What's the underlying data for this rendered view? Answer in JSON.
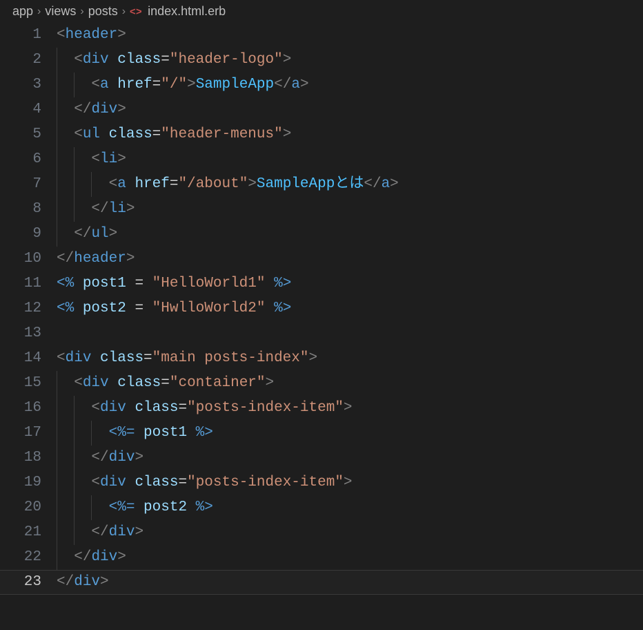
{
  "breadcrumb": {
    "segments": [
      "app",
      "views",
      "posts",
      "index.html.erb"
    ]
  },
  "editor": {
    "activeLine": 23,
    "lineNumbers": [
      "1",
      "2",
      "3",
      "4",
      "5",
      "6",
      "7",
      "8",
      "9",
      "10",
      "11",
      "12",
      "13",
      "14",
      "15",
      "16",
      "17",
      "18",
      "19",
      "20",
      "21",
      "22",
      "23"
    ]
  },
  "code": {
    "l1": {
      "open": "<",
      "tag": "header",
      "close": ">"
    },
    "l2": {
      "indent": 1,
      "open": "<",
      "tag": "div",
      "attr": "class",
      "eq": "=",
      "val": "\"header-logo\"",
      "close": ">"
    },
    "l3": {
      "indent": 2,
      "open": "<",
      "tag": "a",
      "attr": "href",
      "eq": "=",
      "val": "\"/\"",
      "mid": ">",
      "text": "SampleApp",
      "endopen": "</",
      "endtag": "a",
      "endclose": ">"
    },
    "l4": {
      "indent": 1,
      "open": "</",
      "tag": "div",
      "close": ">"
    },
    "l5": {
      "indent": 1,
      "open": "<",
      "tag": "ul",
      "attr": "class",
      "eq": "=",
      "val": "\"header-menus\"",
      "close": ">"
    },
    "l6": {
      "indent": 2,
      "open": "<",
      "tag": "li",
      "close": ">"
    },
    "l7": {
      "indent": 3,
      "open": "<",
      "tag": "a",
      "attr": "href",
      "eq": "=",
      "val": "\"/about\"",
      "mid": ">",
      "text": "SampleAppとは",
      "endopen": "</",
      "endtag": "a",
      "endclose": ">"
    },
    "l8": {
      "indent": 2,
      "open": "</",
      "tag": "li",
      "close": ">"
    },
    "l9": {
      "indent": 1,
      "open": "</",
      "tag": "ul",
      "close": ">"
    },
    "l10": {
      "open": "</",
      "tag": "header",
      "close": ">"
    },
    "l11": {
      "erbopen": "<%",
      "sp": " ",
      "var": "post1",
      "op": " = ",
      "val": "\"HelloWorld1\"",
      "sp2": " ",
      "erbclose": "%>"
    },
    "l12": {
      "erbopen": "<%",
      "sp": " ",
      "var": "post2",
      "op": " = ",
      "val": "\"HwlloWorld2\"",
      "sp2": " ",
      "erbclose": "%>"
    },
    "l13": {
      "blank": ""
    },
    "l14": {
      "open": "<",
      "tag": "div",
      "attr": "class",
      "eq": "=",
      "val": "\"main posts-index\"",
      "close": ">"
    },
    "l15": {
      "indent": 1,
      "open": "<",
      "tag": "div",
      "attr": "class",
      "eq": "=",
      "val": "\"container\"",
      "close": ">"
    },
    "l16": {
      "indent": 2,
      "open": "<",
      "tag": "div",
      "attr": "class",
      "eq": "=",
      "val": "\"posts-index-item\"",
      "close": ">"
    },
    "l17": {
      "indent": 3,
      "erbopen": "<%=",
      "sp": " ",
      "var": "post1",
      "sp2": " ",
      "erbclose": "%>"
    },
    "l18": {
      "indent": 2,
      "open": "</",
      "tag": "div",
      "close": ">"
    },
    "l19": {
      "indent": 2,
      "open": "<",
      "tag": "div",
      "attr": "class",
      "eq": "=",
      "val": "\"posts-index-item\"",
      "close": ">"
    },
    "l20": {
      "indent": 3,
      "erbopen": "<%=",
      "sp": " ",
      "var": "post2",
      "sp2": " ",
      "erbclose": "%>"
    },
    "l21": {
      "indent": 2,
      "open": "</",
      "tag": "div",
      "close": ">"
    },
    "l22": {
      "indent": 1,
      "open": "</",
      "tag": "div",
      "close": ">"
    },
    "l23": {
      "open": "</",
      "tag": "div",
      "close": ">"
    }
  }
}
